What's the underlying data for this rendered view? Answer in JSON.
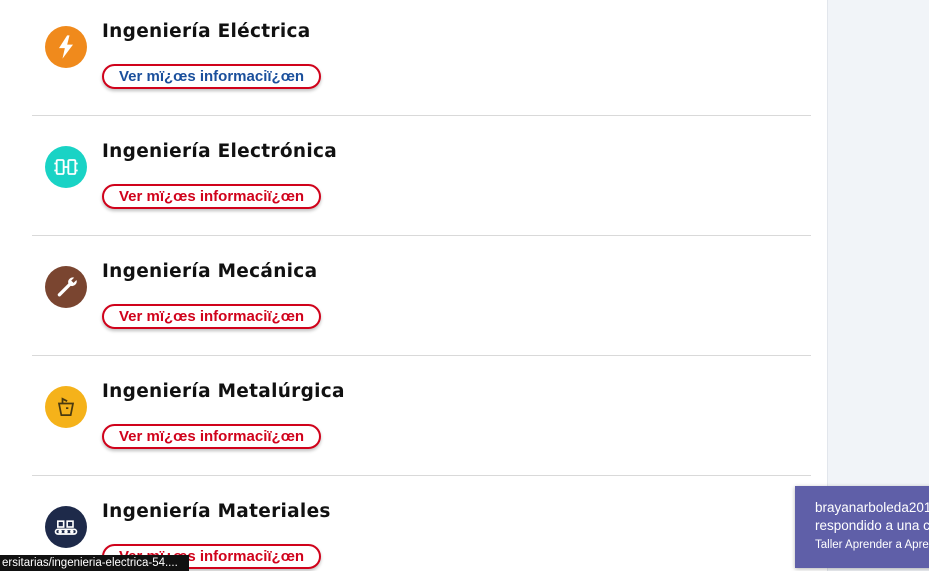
{
  "programs": [
    {
      "name": "Ingeniería Eléctrica",
      "button": "Ver mï¿œs informaciï¿œn",
      "icon": "lightning-bolt-icon",
      "color": "#f08a1c"
    },
    {
      "name": "Ingeniería Electrónica",
      "button": "Ver mï¿œs informaciï¿œn",
      "icon": "circuit-board-icon",
      "color": "#19d3c5"
    },
    {
      "name": "Ingeniería Mecánica",
      "button": "Ver mï¿œs informaciï¿œn",
      "icon": "wrench-icon",
      "color": "#7a4530"
    },
    {
      "name": "Ingeniería Metalúrgica",
      "button": "Ver mï¿œs informaciï¿œn",
      "icon": "crucible-icon",
      "color": "#f5b21a"
    },
    {
      "name": "Ingeniería Materiales",
      "button": "Ver mï¿œs informaciï¿œn",
      "icon": "conveyor-icon",
      "color": "#1e2a4a"
    }
  ],
  "status_bar": {
    "url": "ersitarias/ingenieria-electrica-54...."
  },
  "notification": {
    "line1": "brayanarboleda201",
    "line2": "respondido a una c",
    "line3": "Taller Aprender a Apre"
  },
  "colors": {
    "button_border": "#d0021b",
    "button_text": "#d0021b",
    "button_text_first": "#1a4f9c",
    "notification_bg": "#5f5fa8",
    "sidebar_bg": "#f1f4f8"
  }
}
